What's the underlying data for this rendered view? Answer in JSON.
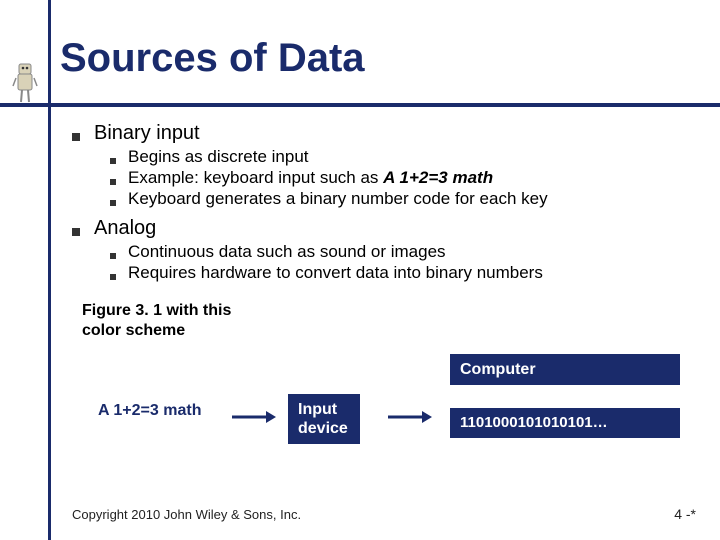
{
  "title": "Sources of Data",
  "bullets": {
    "binary": {
      "label": "Binary input",
      "sub": [
        "Begins as discrete input",
        "Keyboard generates a binary number code for each key"
      ],
      "example_prefix": "Example: keyboard input such as ",
      "example_bold": "A  1+2=3 math"
    },
    "analog": {
      "label": "Analog",
      "sub": [
        "Continuous data such as sound or images",
        "Requires hardware to convert data into binary numbers"
      ]
    }
  },
  "figure_caption_l1": "Figure 3. 1 with this",
  "figure_caption_l2": "color scheme",
  "diagram": {
    "input_text": "A 1+2=3 math",
    "input_device": "Input device",
    "computer": "Computer",
    "binary_stream": "1101000101010101",
    "binary_suffix": "…"
  },
  "footer": {
    "copyright": "Copyright 2010 John Wiley & Sons, Inc.",
    "pagenum": "4 -*"
  },
  "colors": {
    "accent": "#1a2b6b"
  }
}
